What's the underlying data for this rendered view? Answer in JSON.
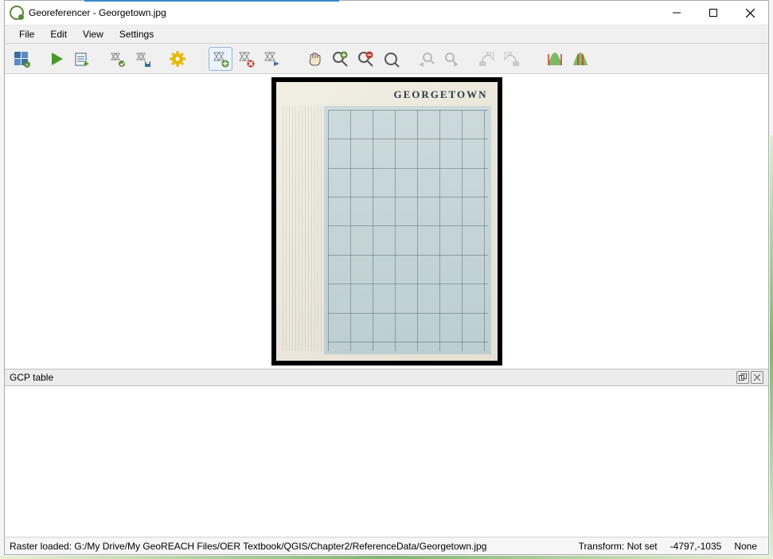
{
  "titlebar": {
    "title": "Georeferencer - Georgetown.jpg"
  },
  "menus": {
    "file": "File",
    "edit": "Edit",
    "view": "View",
    "settings": "Settings"
  },
  "toolbar": {
    "icons": {
      "open_raster": "open-raster-icon",
      "start_georef": "start-georeferencing-icon",
      "generate_script": "generate-script-icon",
      "load_gcp": "load-gcp-points-icon",
      "save_gcp": "save-gcp-points-icon",
      "transformation_settings": "transformation-settings-icon",
      "add_point": "add-point-icon",
      "delete_point": "delete-point-icon",
      "move_point": "move-point-icon",
      "pan": "pan-icon",
      "zoom_in": "zoom-in-icon",
      "zoom_out": "zoom-out-icon",
      "zoom_layer": "zoom-to-layer-icon",
      "zoom_last": "zoom-last-icon",
      "zoom_next": "zoom-next-icon",
      "link_georef": "link-georeferencer-icon",
      "link_qgis": "link-qgis-icon",
      "full_histogram": "full-histogram-stretch-icon",
      "local_histogram": "local-histogram-stretch-icon"
    }
  },
  "map": {
    "title": "GEORGETOWN"
  },
  "gcp": {
    "title": "GCP table"
  },
  "status": {
    "message": "Raster loaded: G:/My Drive/My GeoREACH Files/OER Textbook/QGIS/Chapter2/ReferenceData/Georgetown.jpg",
    "transform_label": "Transform:",
    "transform_value": "Not set",
    "coords": "-4797,-1035",
    "rotation": "None"
  }
}
